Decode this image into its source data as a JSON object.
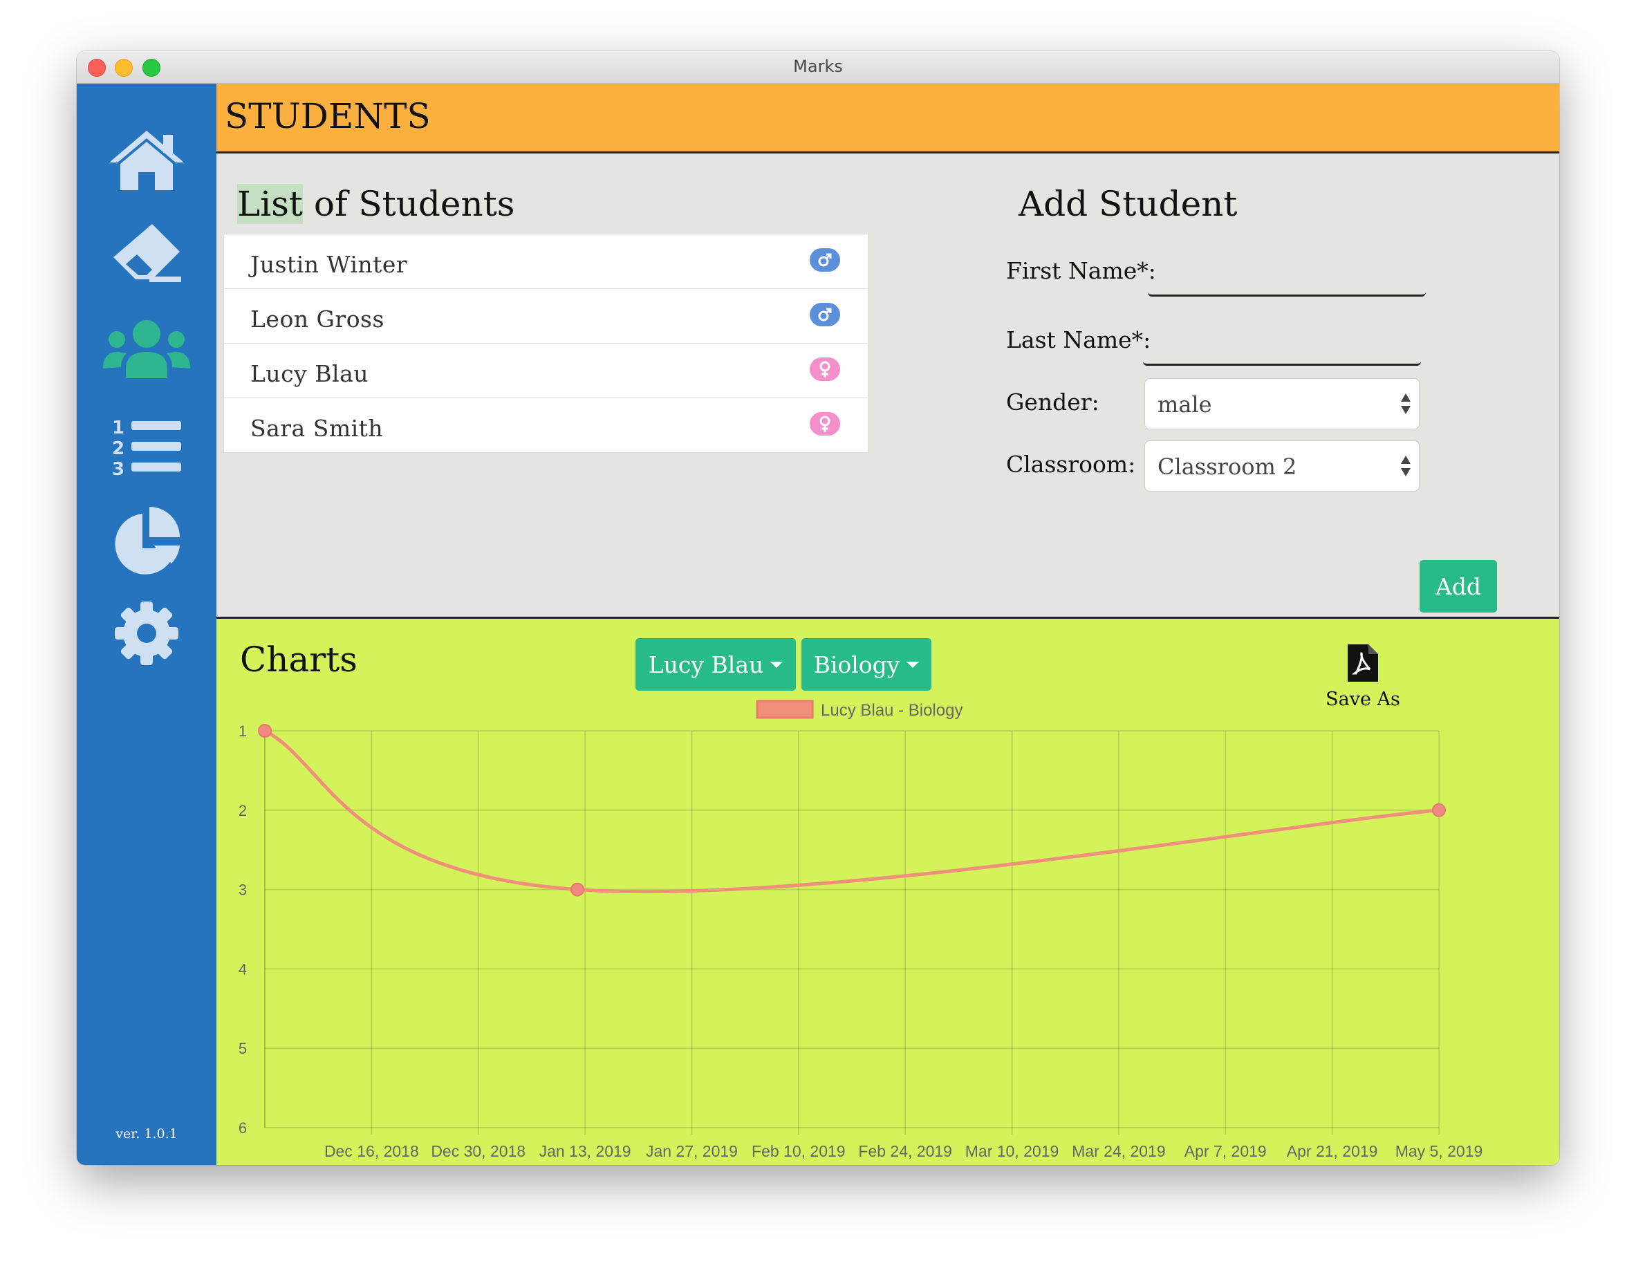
{
  "window": {
    "title": "Marks"
  },
  "sidebar": {
    "items": [
      {
        "name": "home",
        "icon": "home-icon"
      },
      {
        "name": "subjects",
        "icon": "eraser-icon"
      },
      {
        "name": "students",
        "icon": "users-icon",
        "active": true
      },
      {
        "name": "marks",
        "icon": "numbered-list-icon"
      },
      {
        "name": "charts",
        "icon": "pie-chart-icon"
      },
      {
        "name": "settings",
        "icon": "gear-icon"
      }
    ],
    "version": "ver. 1.0.1",
    "icon_color": "#cfe0f3",
    "active_color": "#2eb58f"
  },
  "header": {
    "title": "STUDENTS"
  },
  "student_list": {
    "title_highlight": "List",
    "title_rest": " of Students",
    "students": [
      {
        "name": "Justin Winter",
        "gender": "male",
        "symbol": "♂"
      },
      {
        "name": "Leon Gross",
        "gender": "male",
        "symbol": "♂"
      },
      {
        "name": "Lucy Blau",
        "gender": "female",
        "symbol": "♀"
      },
      {
        "name": "Sara Smith",
        "gender": "female",
        "symbol": "♀"
      }
    ]
  },
  "add_student": {
    "title": "Add Student",
    "first_name_label": "First Name*:",
    "first_name_value": "",
    "last_name_label": "Last Name*:",
    "last_name_value": "",
    "gender_label": "Gender:",
    "gender_value": "male",
    "classroom_label": "Classroom:",
    "classroom_value": "Classroom 2",
    "add_label": "Add"
  },
  "charts": {
    "title": "Charts",
    "student_dropdown": "Lucy Blau",
    "subject_dropdown": "Biology",
    "save_label": "Save As",
    "save_icon": "pdf-file-icon"
  },
  "chart_data": {
    "type": "line",
    "series": [
      {
        "name": "Lucy Blau - Biology",
        "color": "#f0907a",
        "points": [
          {
            "x": "2018-12-02",
            "y": 1
          },
          {
            "x": "2019-01-12",
            "y": 3
          },
          {
            "x": "2019-05-05",
            "y": 2
          }
        ]
      }
    ],
    "x_ticks": [
      "Dec 16, 2018",
      "Dec 30, 2018",
      "Jan 13, 2019",
      "Jan 27, 2019",
      "Feb 10, 2019",
      "Feb 24, 2019",
      "Mar 10, 2019",
      "Mar 24, 2019",
      "Apr 7, 2019",
      "Apr 21, 2019",
      "May 5, 2019"
    ],
    "y_ticks": [
      "1",
      "2",
      "3",
      "4",
      "5",
      "6"
    ],
    "ylim": [
      1,
      6
    ],
    "y_reversed": true,
    "grid": true,
    "legend": "top-center"
  }
}
